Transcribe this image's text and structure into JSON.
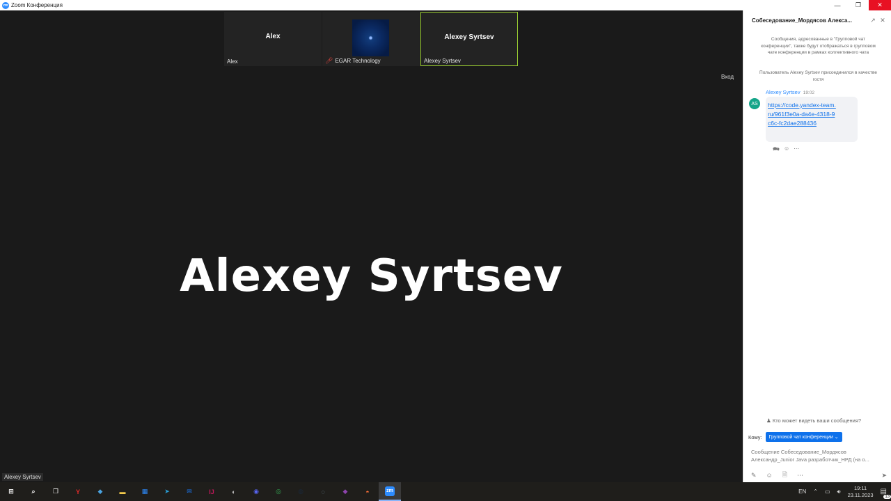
{
  "window": {
    "app_logo": "zm",
    "title": "Zoom Конференция"
  },
  "tiles": [
    {
      "big_name": "Alex",
      "small_name": "Alex",
      "muted": false,
      "active": false
    },
    {
      "big_name": "",
      "small_name": "EGAR Technology",
      "muted": true,
      "active": false
    },
    {
      "big_name": "Alexey Syrtsev",
      "small_name": "Alexey Syrtsev",
      "muted": false,
      "active": true
    }
  ],
  "main": {
    "enter_label": "Вход",
    "speaker_name": "Alexey Syrtsev",
    "speaker_badge": "Alexey Syrtsev"
  },
  "chat": {
    "title": "Собеседование_Мордясов Алекса...",
    "system_message_1": "Сообщения, адресованные в \"Групповой чат конференции\", также будут отображаться в групповом чате конференции в рамках коллективного чата",
    "system_message_2": "Пользователь Alexey Syrtsev присоединился в качестве гостя",
    "message": {
      "avatar_initials": "AS",
      "sender": "Alexey Syrtsev",
      "time": "19:02",
      "link": "https://code.yandex-team.ru/961f3e0a-da4e-4318-9c6c-fc2dae288436"
    },
    "who_sees": "Кто может видеть ваши сообщения?",
    "to_label": "Кому:",
    "to_value": "Групповой чат конференции",
    "compose_placeholder": "Сообщение Собеседование_Мордясов Александр_Junior Java разработчик_НРД (на о..."
  },
  "taskbar": {
    "items": [
      {
        "icon": "windows-start-icon",
        "label": "⊞",
        "color": "#ffffff"
      },
      {
        "icon": "search-icon",
        "label": "⌕",
        "color": "#ffffff"
      },
      {
        "icon": "task-view-icon",
        "label": "❐",
        "color": "#ffffff"
      },
      {
        "icon": "yandex-browser-icon",
        "label": "Y",
        "color": "#e02a2a"
      },
      {
        "icon": "app-icon",
        "label": "◆",
        "color": "#4aa3e0"
      },
      {
        "icon": "file-explorer-icon",
        "label": "▬",
        "color": "#f2c94c"
      },
      {
        "icon": "store-icon",
        "label": "▦",
        "color": "#2d8cff"
      },
      {
        "icon": "telegram-icon",
        "label": "➤",
        "color": "#2aa1da"
      },
      {
        "icon": "mail-icon",
        "label": "✉",
        "color": "#1a73e8"
      },
      {
        "icon": "intellij-icon",
        "label": "IJ",
        "color": "#c2185b"
      },
      {
        "icon": "app-icon-2",
        "label": "◐",
        "color": "#cccccc"
      },
      {
        "icon": "discord-icon",
        "label": "◉",
        "color": "#5865f2"
      },
      {
        "icon": "chrome-icon",
        "label": "◎",
        "color": "#34a853"
      },
      {
        "icon": "steam-icon",
        "label": "◍",
        "color": "#1b2838"
      },
      {
        "icon": "app-icon-3",
        "label": "◌",
        "color": "#7ca0b8"
      },
      {
        "icon": "git-icon",
        "label": "◆",
        "color": "#8e44ad"
      },
      {
        "icon": "firefox-icon",
        "label": "◓",
        "color": "#ff7139"
      },
      {
        "icon": "zoom-icon",
        "label": "zm",
        "color": "#2d8cff"
      }
    ],
    "lang": "EN",
    "time": "19:11",
    "date": "23.11.2023",
    "notifications": "13"
  }
}
